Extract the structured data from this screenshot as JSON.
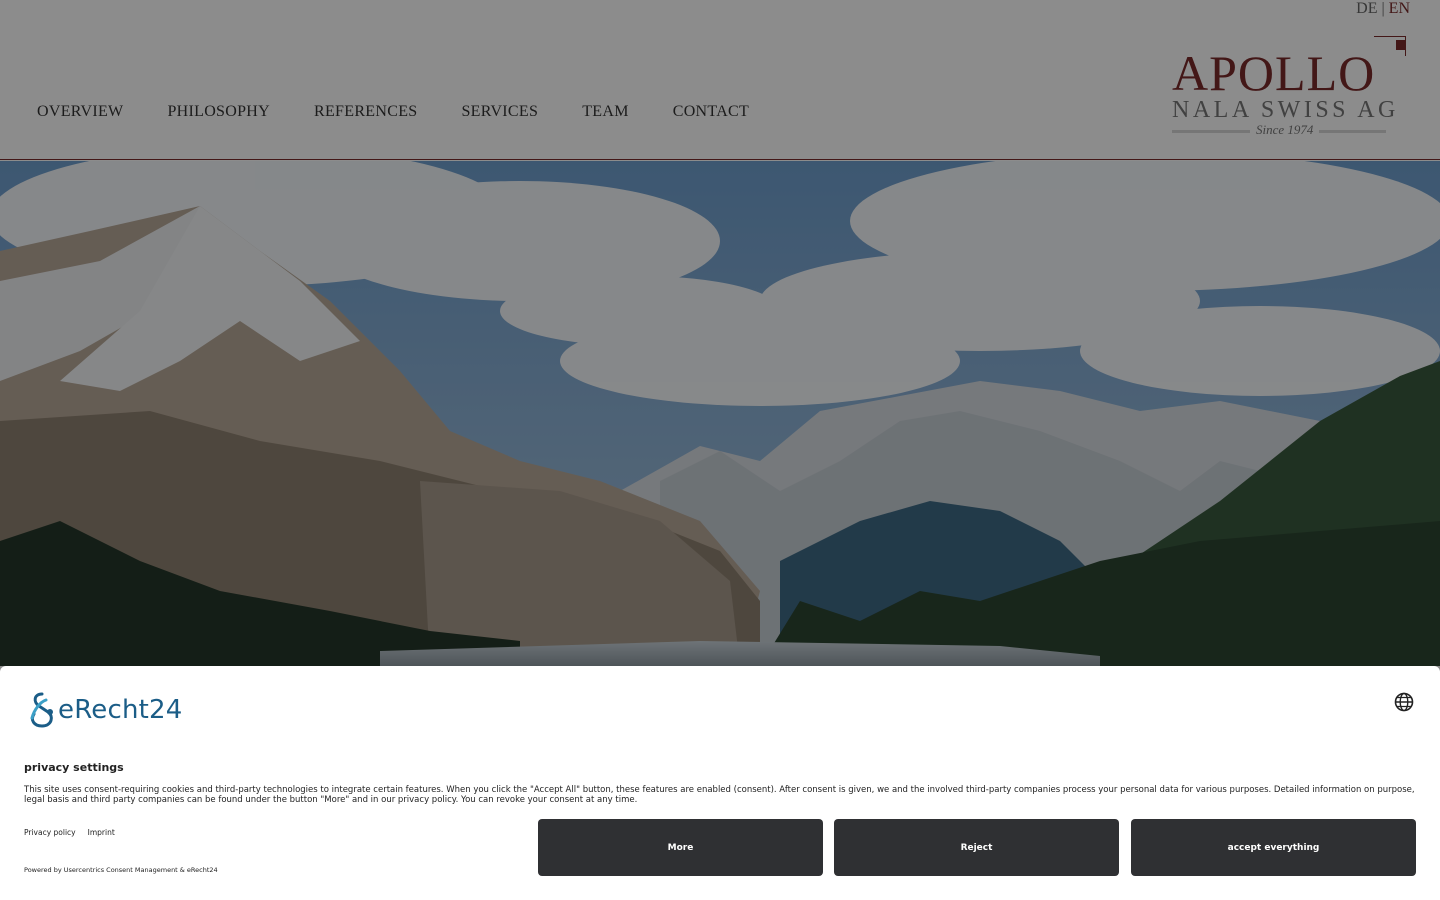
{
  "header": {
    "languages": [
      "DE",
      "EN"
    ],
    "language_separator": "|",
    "active_language": "EN",
    "nav": [
      "OVERVIEW",
      "PHILOSOPHY",
      "REFERENCES",
      "SERVICES",
      "TEAM",
      "CONTACT"
    ],
    "logo": {
      "main": "APOLLO",
      "sub": "NALA SWISS AG",
      "since": "Since 1974"
    }
  },
  "hero": {
    "image": "mountain-valley-landscape"
  },
  "consent": {
    "brand": "eRecht24",
    "title": "privacy settings",
    "text": "This site uses consent-requiring cookies and third-party technologies to integrate certain features. When you click the \"Accept All\" button, these features are enabled (consent). After consent is given, we and the involved third-party companies process your personal data for various purposes. Detailed information on purpose, legal basis and third party companies can be found under the button \"More\" and in our privacy policy. You can revoke your consent at any time.",
    "links": [
      "Privacy policy",
      "Imprint"
    ],
    "powered_by": "Powered by Usercentrics Consent Management & eRecht24",
    "buttons": {
      "more": "More",
      "reject": "Reject",
      "accept": "accept everything"
    },
    "icon": "globe-icon"
  },
  "colors": {
    "accent": "#7a2a2a",
    "brand_blue": "#1b5d87",
    "button_dark": "#2f3033"
  }
}
